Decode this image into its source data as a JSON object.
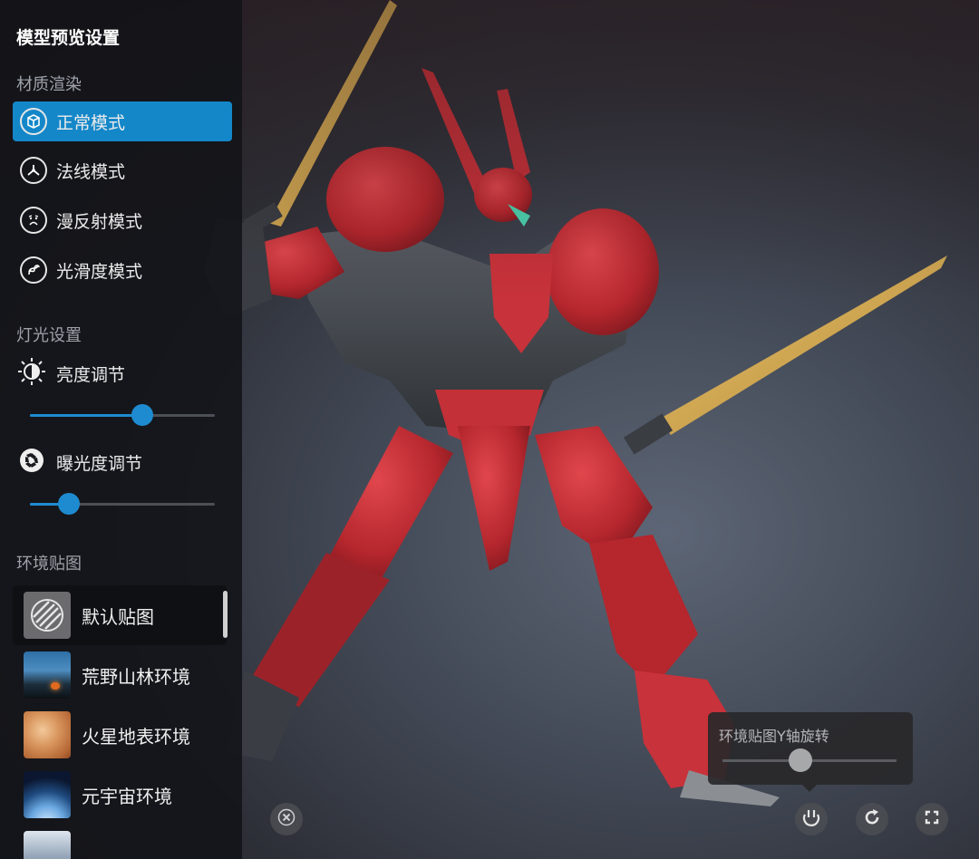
{
  "panel": {
    "title": "模型预览设置"
  },
  "material": {
    "section_title": "材质渲染",
    "modes": [
      {
        "label": "正常模式",
        "icon": "cube-icon",
        "active": true
      },
      {
        "label": "法线模式",
        "icon": "tri-branch-icon",
        "active": false
      },
      {
        "label": "漫反射模式",
        "icon": "sad-face-icon",
        "active": false
      },
      {
        "label": "光滑度模式",
        "icon": "wave-icon",
        "active": false
      }
    ]
  },
  "lighting": {
    "section_title": "灯光设置",
    "brightness": {
      "label": "亮度调节",
      "icon": "sun-icon",
      "value": 0.61
    },
    "exposure": {
      "label": "曝光度调节",
      "icon": "aperture-icon",
      "value": 0.21
    }
  },
  "environment": {
    "section_title": "环境贴图",
    "items": [
      {
        "label": "默认贴图",
        "thumb": "default",
        "selected": true
      },
      {
        "label": "荒野山林环境",
        "thumb": "forest",
        "selected": false
      },
      {
        "label": "火星地表环境",
        "thumb": "mars",
        "selected": false
      },
      {
        "label": "元宇宙环境",
        "thumb": "cosmos",
        "selected": false
      },
      {
        "label": "",
        "thumb": "partial",
        "selected": false
      }
    ]
  },
  "rotation_panel": {
    "title": "环境贴图Y轴旋转",
    "value": 0.45
  },
  "accent_color": "#1487c9",
  "toolbar": {
    "close_icon": "close-icon",
    "rotate_y_icon": "env-rotate-icon",
    "refresh_icon": "refresh-icon",
    "fullscreen_icon": "fullscreen-icon"
  }
}
